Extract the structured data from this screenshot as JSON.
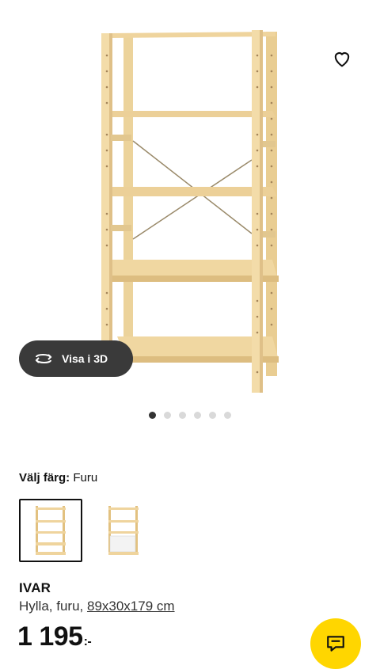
{
  "product": {
    "name": "IVAR",
    "description_prefix": "Hylla, furu, ",
    "dimensions": "89x30x179 cm",
    "price_main": "1 195",
    "price_suffix": ":-"
  },
  "gallery": {
    "view_3d_label": "Visa i 3D",
    "image_count": 6,
    "active_index": 0
  },
  "color_selector": {
    "label": "Välj färg:",
    "selected_value": "Furu",
    "options": [
      "furu",
      "furu-vit"
    ]
  },
  "icons": {
    "favorite": "heart-icon",
    "view_3d": "rotate-3d-icon",
    "chat": "chat-icon"
  },
  "colors": {
    "wood": "#f1d9a4",
    "wood_dark": "#d9b777",
    "badge_bg": "#3a3a3a",
    "chat_bg": "#ffd600"
  }
}
